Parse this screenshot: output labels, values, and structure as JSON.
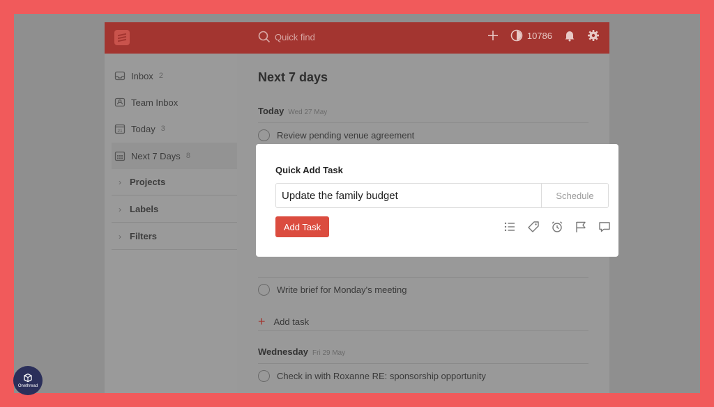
{
  "topbar": {
    "search_placeholder": "Quick find",
    "karma": "10786",
    "icons": [
      "todoist-logo-icon",
      "search-icon",
      "plus-icon",
      "karma-icon",
      "bell-icon",
      "gear-icon"
    ]
  },
  "sidebar": {
    "items": [
      {
        "label": "Inbox",
        "count": "2",
        "icon": "inbox-icon"
      },
      {
        "label": "Team Inbox",
        "count": "",
        "icon": "team-inbox-icon"
      },
      {
        "label": "Today",
        "count": "3",
        "icon": "calendar-today-icon"
      },
      {
        "label": "Next 7 Days",
        "count": "8",
        "icon": "calendar-week-icon"
      }
    ],
    "sections": [
      {
        "label": "Projects"
      },
      {
        "label": "Labels"
      },
      {
        "label": "Filters"
      }
    ]
  },
  "main": {
    "title": "Next 7 days",
    "days": [
      {
        "name": "Today",
        "date": "Wed 27 May"
      },
      {
        "name": "Wednesday",
        "date": "Fri 29 May"
      }
    ],
    "tasks": [
      "Review pending venue agreement",
      "Write brief for Monday's meeting",
      "Check in with Roxanne RE: sponsorship opportunity"
    ],
    "add_task_label": "Add task"
  },
  "modal": {
    "title": "Quick Add Task",
    "input_value": "Update the family budget",
    "schedule_label": "Schedule",
    "add_button": "Add Task",
    "icons": [
      "project-list-icon",
      "label-tag-icon",
      "alarm-clock-icon",
      "flag-icon",
      "comment-icon"
    ]
  },
  "brand": {
    "label": "Onethread"
  },
  "colors": {
    "accent": "#db4c3f",
    "topbar": "#a33530",
    "border": "#f15a5b"
  }
}
